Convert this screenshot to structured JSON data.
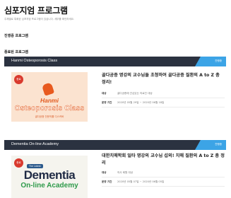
{
  "page": {
    "title": "심포지엄 프로그램",
    "description": "주제별로 특화된 심포지엄 프로그램이 있습니다. 세부를 확인하세요.",
    "nav_ongoing": "진행중 프로그램",
    "nav_done": "종료된 프로그램"
  },
  "programs": [
    {
      "header_title": "Hanmi Osteoporosis Class",
      "status": "진행중",
      "badge": "종료",
      "thumb": {
        "brand": "Hanmi",
        "title": "Osteoporosis Class",
        "subtitle": "골다공증 전문의를 디스커버"
      },
      "headline": "골다공증 명강의 교수님들 초청하여 골다공증 질환의 A to Z 총 정리!",
      "rows": [
        {
          "label": "대상",
          "value": "골다공증에 관심있는 의료진 대상"
        },
        {
          "label": "운영 기간",
          "value": "2020년 05월 29일 ~ 2020년 06월 18일"
        }
      ]
    },
    {
      "header_title": "Dementia On-line Academy",
      "status": "진행중",
      "badge": "종료",
      "thumb": {
        "tag": "The Latest",
        "title": "Dementia",
        "subtitle": "On-line Academy"
      },
      "headline": "대한치매학회 일타 명강의 교수님 섭외! 치매 질환의 A to Z 총 정리",
      "rows": [
        {
          "label": "대상",
          "value": "의사 회원 대상"
        },
        {
          "label": "운영 기간",
          "value": "2020년 05월 07일 ~ 2020년 06월 05일"
        }
      ]
    }
  ],
  "colors": {
    "header_bg": "#2b3240",
    "status_accent": "#3ca4e6",
    "badge": "#d93a2e"
  }
}
